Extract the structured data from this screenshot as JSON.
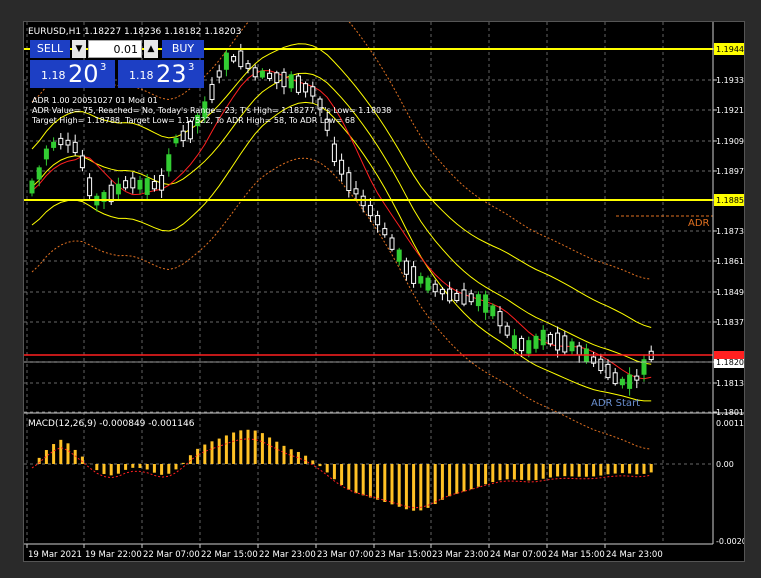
{
  "window": {
    "header": "EURUSD,H1  1.18227 1.18236 1.18182 1.18203"
  },
  "trade_panel": {
    "sell_label": "SELL",
    "buy_label": "BUY",
    "lot_value": "0.01",
    "lot_down": "▼",
    "lot_up": "▲",
    "sell_price_prefix": "1.18",
    "sell_price_big": "20",
    "sell_price_sup": "3",
    "buy_price_prefix": "1.18",
    "buy_price_big": "23",
    "buy_price_sup": "3"
  },
  "adr_info": {
    "line1": "ADR 1.00 20051027 01 Mod 01",
    "line2": "ADR Value= 75, Reached= No, Today's Range= 23, T's High= 1.18277, T's Low= 1.18038",
    "line3": "Target High= 1.18788, Target Low= 1.17522, To ADR High= 58, To ADR Low= 68"
  },
  "labels": {
    "adr_right": "ADR",
    "adr_start": "ADR Start",
    "macd_header": "MACD(12,26,9) -0.000849 -0.001146"
  },
  "price_axis": {
    "ticks": [
      "1.19448",
      "1.19330",
      "1.19210",
      "1.19090",
      "1.18970",
      "1.18852",
      "1.18730",
      "1.18610",
      "1.18490",
      "1.18370",
      "1.18203",
      "1.18130",
      "1.18010"
    ],
    "highlight_labels": [
      "1.19448",
      "1.18852"
    ],
    "current_price": "1.18203"
  },
  "macd_axis": {
    "ticks": [
      "0.0011",
      "0.00",
      "-0.002034"
    ]
  },
  "time_axis": {
    "ticks": [
      "19 Mar 2021",
      "19 Mar 22:00",
      "22 Mar 07:00",
      "22 Mar 15:00",
      "22 Mar 23:00",
      "23 Mar 07:00",
      "23 Mar 15:00",
      "23 Mar 23:00",
      "24 Mar 07:00",
      "24 Mar 15:00",
      "24 Mar 23:00"
    ]
  },
  "colors": {
    "background": "#000000",
    "grid": "#8c8c8c",
    "bull_candle": "#32cd32",
    "bear_candle": "#ffffff",
    "yellow_line": "#ffff00",
    "red_line": "#ff2020",
    "macd_hist": "#ffc125",
    "panel_blue": "#1d3fc4"
  }
}
